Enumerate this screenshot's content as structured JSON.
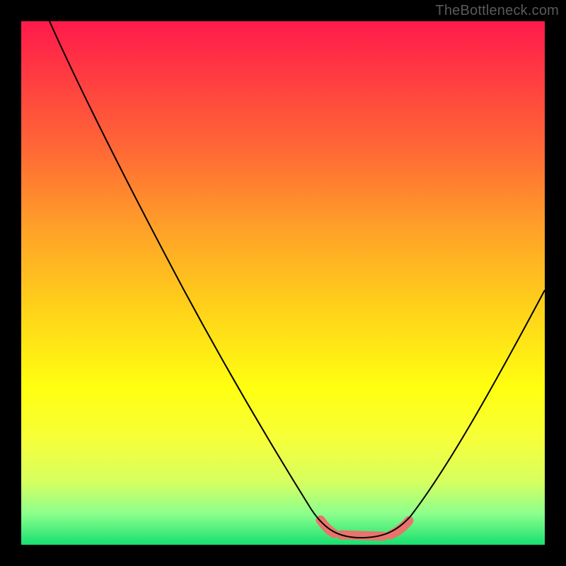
{
  "watermark": "TheBottleneck.com",
  "colors": {
    "background": "#000000",
    "gradient_top": "#ff1a4b",
    "gradient_mid": "#ffff10",
    "gradient_bottom": "#18e070",
    "curve": "#000000",
    "highlight": "#e8746c"
  },
  "chart_data": {
    "type": "line",
    "title": "",
    "xlabel": "",
    "ylabel": "",
    "xlim": [
      0,
      100
    ],
    "ylim": [
      0,
      100
    ],
    "series": [
      {
        "name": "bottleneck-curve",
        "x": [
          0,
          5,
          10,
          15,
          20,
          25,
          30,
          35,
          40,
          45,
          50,
          55,
          58,
          60,
          62,
          65,
          68,
          70,
          72,
          75,
          80,
          85,
          90,
          95,
          100
        ],
        "y": [
          100,
          94,
          86,
          78,
          70,
          62,
          54,
          46,
          38,
          30,
          22,
          14,
          8,
          5,
          3,
          2,
          2,
          2,
          3,
          5,
          12,
          22,
          33,
          44,
          55
        ]
      }
    ],
    "annotations": [
      {
        "name": "optimal-zone",
        "x_range": [
          58,
          74
        ],
        "y_approx": 2,
        "note": "highlighted low-bottleneck region"
      }
    ]
  }
}
